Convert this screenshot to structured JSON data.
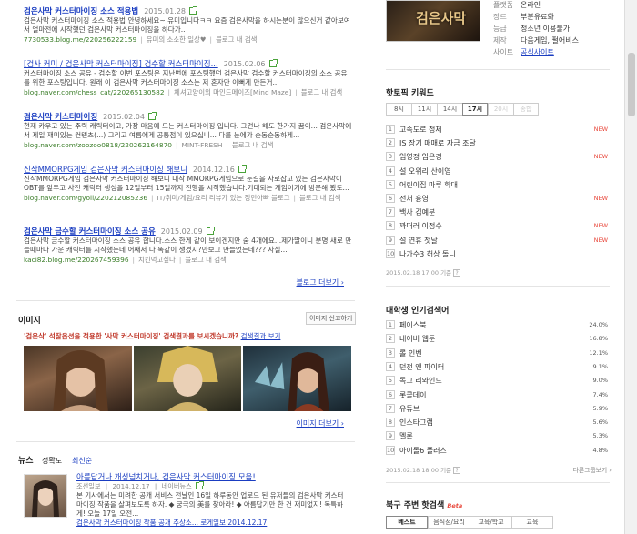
{
  "results": [
    {
      "title": "검은사막 커스터마이징 소스 적용법",
      "date": "2015.01.28",
      "snippet": "검은사막 커스터마이징 소스 적용법 안녕하세요~ 유미입니다ㅋㅋ 요즘 검은사막을 하시는분이 많으신거 같아보여서 얼마전에 시작했던 검은사막 커스터마이징을 하다가..",
      "source": "7730533.blog.me/220256222159",
      "author": "유미의 소소한 일상♥",
      "inlink": "블로그 내 검색"
    },
    {
      "title": "[검사 커미 / 검은사막 커스터마이징] 검수할 커스터마이징...",
      "date": "2015.02.06",
      "snippet": "커스터마이징 소스 공유 - 검수할 이번 포스팅은 지난번에 포스팅했던 검은사막 검수할 커스터마이징의 소스 공유를 위한 포스팅입니다. 원래 이 검은사막 커스터마이징 소스는 저 혼자만 이뻐게 만든거...",
      "source": "blog.naver.com/chess_cat/220265130582",
      "author": "체셔고양이의 마인드메이즈[Mind Maze]",
      "inlink": "블로그 내 검색"
    },
    {
      "title": "검은사막 커스터마이징",
      "date": "2015.02.04",
      "snippet": "현재 카우고 있는 주력 캐릭터이고, 가장 마음에 드는 커스터마이징 입니다. 그런나 해도 한가지 꿈이... 검은사막에서 제일 재미있는 컨텐츠(...) 그리고 여름에게 공통점이 있으십니... 다를 눈에가 순동순동하게...",
      "source": "blog.naver.com/zoozoo0818/220262164870",
      "author": "MINT-FRESH",
      "inlink": "블로그 내 검색"
    },
    {
      "title": "신작MMORPG게임 검은사막 커스터마이징 해보니",
      "date": "2014.12.16",
      "snippet": "신작MMORPG게임 검은사막 커스터마이징 해보니 대작 MMORPG게임으로 눈길을 사로잡고 있는 검은사막이 OBT를 앞두고 사전 캐릭터 생성을 12일부터 15일까지 진행을 시작했습니다.기대되는 게임이기에 방문해 봤도...",
      "source": "blog.naver.com/gyoil/220212085236",
      "author": "IT/취미/게임/요리 리뷰가 있는 정민아빠 블로그",
      "inlink": "블로그 내 검색"
    },
    {
      "title": "검은사막 금수할 커스터마이징 소스 공유",
      "date": "2015.02.09",
      "snippet": "검은사막 금수할 커스터마이징 소스 공유 합니다.소스 한게 같이 보이겐지만 숨 4개에요...제가딸이니 분명 새로 만들때마다 가운 캐릭터를 시작했는데 어째서 다 똑같이 생겼지?만보고 만들었는데??? 사실...",
      "source": "kaci82.blog.me/220267459396",
      "author": "치킨먹고싶다",
      "inlink": "블로그 내 검색"
    }
  ],
  "blog_more": "블로그 더보기",
  "image_section": {
    "title": "이미지",
    "report_btn": "이미지 신고하기",
    "notice_pre": "'검은삭' 석잘옵션을 적용한 '사막 커스터마이징' 검색결과를 보시겠습니까?",
    "notice_link": "검색결과 보기",
    "more": "이미지 더보기"
  },
  "news_section": {
    "title": "뉴스",
    "tabs": [
      "정확도",
      "최신순"
    ],
    "item_title": "아름답거나 개성넘치거나, 검은사막 커스터마이징 모음!",
    "item_meta_src": "조선일보",
    "item_meta_date": "2014.12.17",
    "item_meta_link": "네이버뉴스",
    "item_snippet": "본 기사에서는 미려한 공개 서비스 전날인 16일 하루동안 업로드 된 유저들의 검은사막 커스터마이징 작품을 살펴보도록 하자. ◆ 궁극의 美를 찾아라! ◆ 아름답기만 한 건 재미없지! 독특하게! 오늘 17일 오전...",
    "item2": "검은사막 커스터마이징 작품 공개 추상소... 로게일보 2014.12.17"
  },
  "right": {
    "game_logo": "검은사막",
    "info": [
      {
        "k": "플랫폼",
        "v": "온라인"
      },
      {
        "k": "장르",
        "v": "부분유료화"
      },
      {
        "k": "등급",
        "v": "청소년 이용불가"
      },
      {
        "k": "제작",
        "v": "다음게임, 펄어비스"
      },
      {
        "k": "사이트",
        "v": "공식사이트"
      }
    ],
    "hot_title": "핫토픽 키워드",
    "hot_tabs": [
      "8시",
      "11시",
      "14시",
      "17시",
      "20시",
      "종합"
    ],
    "hot_list": [
      {
        "n": "1",
        "t": "고속도로 정체",
        "badge": "NEW"
      },
      {
        "n": "2",
        "t": "IS 장기 매매로 자금 조달",
        "badge": ""
      },
      {
        "n": "3",
        "t": "임영정 임은경",
        "badge": "NEW"
      },
      {
        "n": "4",
        "t": "설 오위리 산이영",
        "badge": ""
      },
      {
        "n": "5",
        "t": "어린이집 마루 학대",
        "badge": ""
      },
      {
        "n": "6",
        "t": "전처 흉영",
        "badge": "NEW"
      },
      {
        "n": "7",
        "t": "백사 김예분",
        "badge": ""
      },
      {
        "n": "8",
        "t": "꽈떠러 이정수",
        "badge": "NEW"
      },
      {
        "n": "9",
        "t": "설 연휴 첫날",
        "badge": "NEW"
      },
      {
        "n": "10",
        "t": "나가수3 허상 돌니",
        "badge": ""
      }
    ],
    "hot_stamp": "2015.02.18 17:00 기준",
    "univ_title": "대학생 인기검색어",
    "univ_list": [
      {
        "n": "1",
        "t": "페이스북",
        "p": "24.0%"
      },
      {
        "n": "2",
        "t": "네이버 웹툰",
        "p": "16.8%"
      },
      {
        "n": "3",
        "t": "롤 인벤",
        "p": "12.1%"
      },
      {
        "n": "4",
        "t": "던전 앤 파이터",
        "p": "9.1%"
      },
      {
        "n": "5",
        "t": "독고 리와인드",
        "p": "9.0%"
      },
      {
        "n": "6",
        "t": "롯콜데이",
        "p": "7.4%"
      },
      {
        "n": "7",
        "t": "유튜브",
        "p": "5.9%"
      },
      {
        "n": "8",
        "t": "인스타그램",
        "p": "5.6%"
      },
      {
        "n": "9",
        "t": "멜론",
        "p": "5.3%"
      },
      {
        "n": "10",
        "t": "아이돌6 플러스",
        "p": "4.8%"
      }
    ],
    "univ_stamp": "2015.02.18 18:00 기준",
    "univ_more": "다른그룹보기",
    "local_title": "북구 주변 핫검색",
    "local_badge": "Beta",
    "local_tabs": [
      "베스트",
      "음식점/요리",
      "교육/학교",
      "교육"
    ]
  }
}
